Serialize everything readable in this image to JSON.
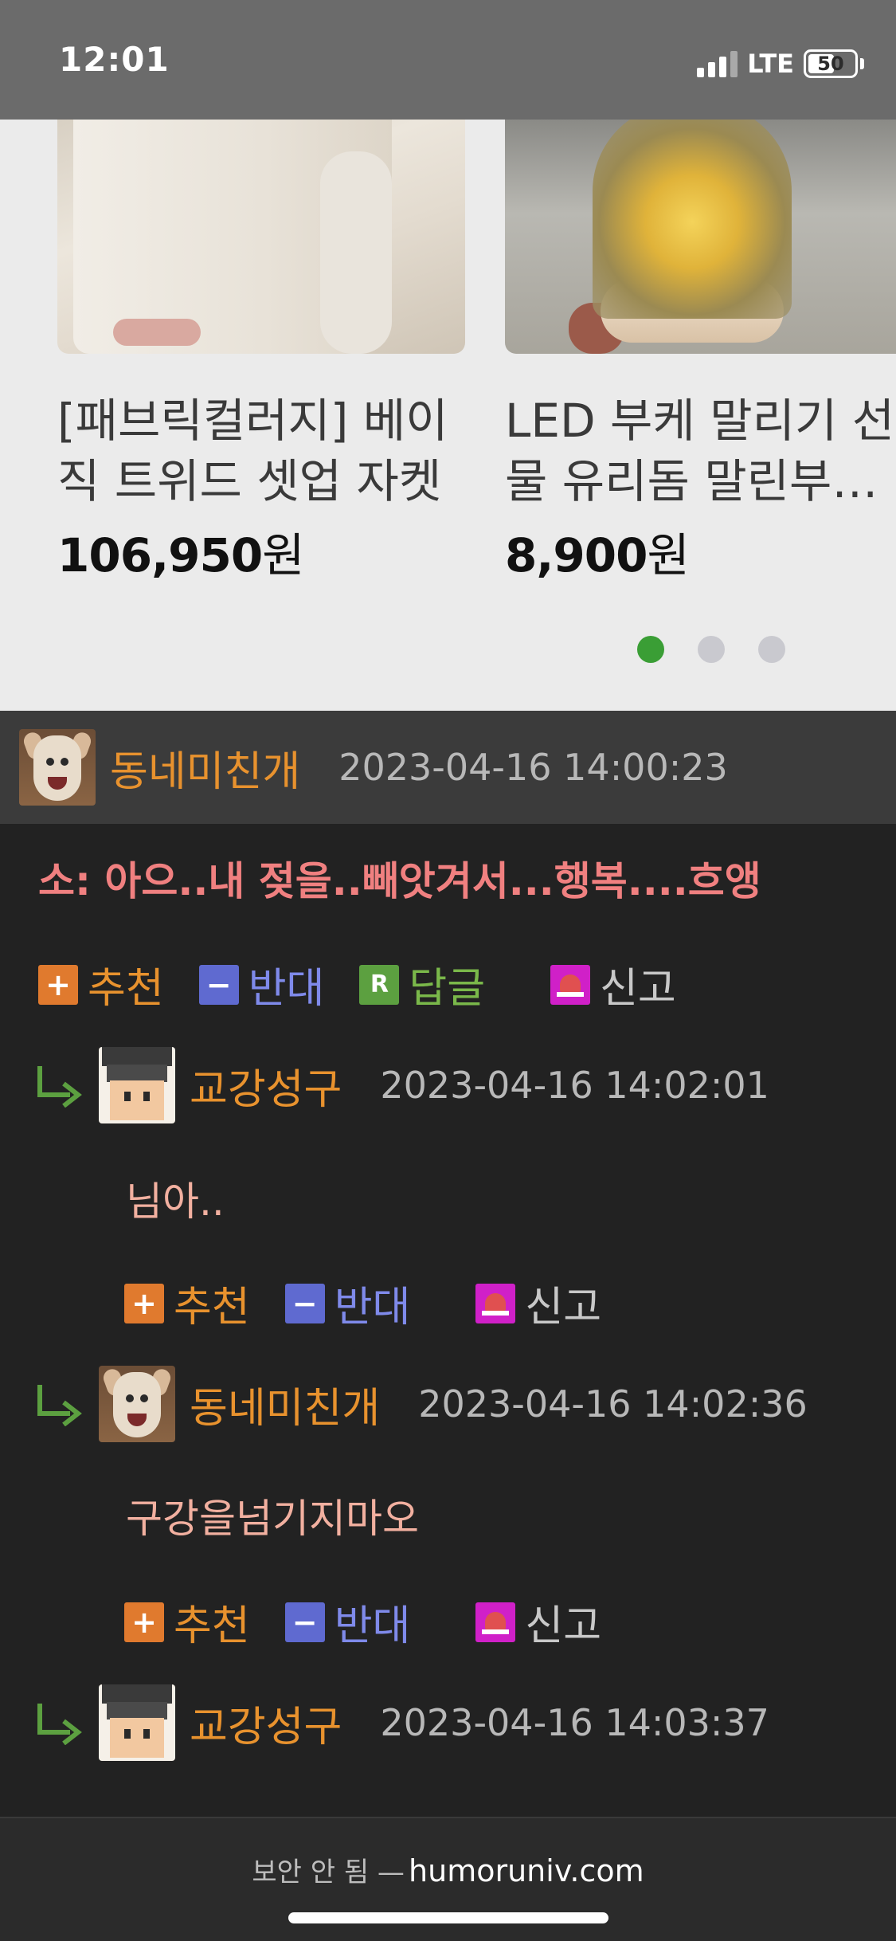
{
  "status_bar": {
    "time": "12:01",
    "network": "LTE",
    "battery": "50"
  },
  "carousel": {
    "products": [
      {
        "title_line1": "[패브릭컬러지] 베이",
        "title_line2": "직 트위드 셋업 자켓",
        "price_number": "106,950",
        "price_unit": "원"
      },
      {
        "title_line1": "LED 부케 말리기 선",
        "title_line2": "물 유리돔 말린부…",
        "price_number": "8,900",
        "price_unit": "원"
      }
    ],
    "page_indicator": {
      "total": 3,
      "active": 1
    }
  },
  "comment": {
    "nickname": "동네미친개",
    "date": "2023-04-16 14:00:23",
    "text": "소: 아으..내 젖을..빼앗겨서...행복....흐앵",
    "actions": {
      "recommend": "추천",
      "oppose": "반대",
      "reply": "답글",
      "report": "신고"
    }
  },
  "replies": [
    {
      "nickname": "교강성구",
      "date": "2023-04-16 14:02:01",
      "text": "님아..",
      "recommend": "추천",
      "oppose": "반대",
      "report": "신고"
    },
    {
      "nickname": "동네미친개",
      "date": "2023-04-16 14:02:36",
      "text": "구강을넘기지마오",
      "recommend": "추천",
      "oppose": "반대",
      "report": "신고"
    },
    {
      "nickname": "교강성구",
      "date": "2023-04-16 14:03:37"
    }
  ],
  "browser": {
    "security": "보안 안 됨 —",
    "domain": "humoruniv.com"
  },
  "colors": {
    "nickname": "#e8922e",
    "recommend": "#e07a2e",
    "oppose": "#5f6ad0",
    "reply": "#5ca040",
    "report": "#d020c8",
    "active_dot": "#3a9e35"
  },
  "icons": [
    "signal-icon",
    "battery-icon",
    "plus-icon",
    "minus-icon",
    "reply-r-icon",
    "siren-icon",
    "reply-arrow-icon"
  ]
}
